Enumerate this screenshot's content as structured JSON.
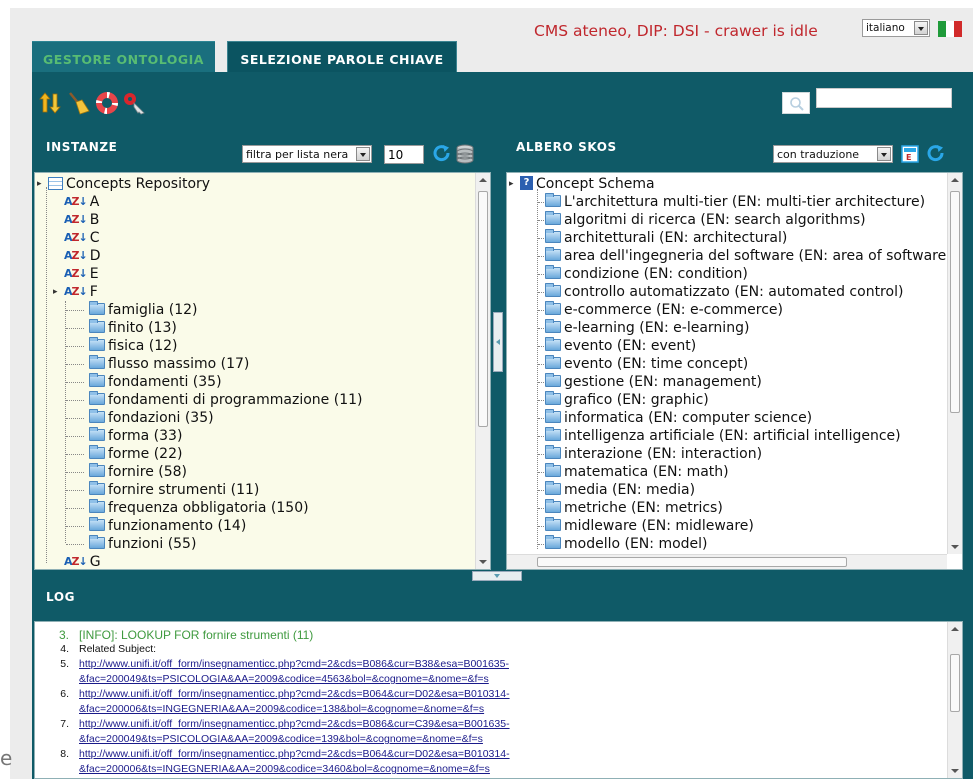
{
  "header": {
    "status": "CMS ateneo, DIP: DSI - crawer is idle",
    "language": "italiano",
    "flag_colors": [
      "#1f9b3a",
      "#ffffff",
      "#d12a2a"
    ]
  },
  "tabs": [
    {
      "label": "GESTORE ONTOLOGIA",
      "active": false
    },
    {
      "label": "SELEZIONE PAROLE CHIAVE",
      "active": true
    }
  ],
  "toolbar": {
    "icons": [
      "sort-arrows-icon",
      "broom-icon",
      "lifebuoy-icon",
      "key-icon"
    ],
    "search_placeholder": ""
  },
  "instanze": {
    "title": "INSTANZE",
    "filter": "filtra per lista nera",
    "limit": "10",
    "root": "Concepts Repository",
    "letters": [
      "A",
      "B",
      "C",
      "D",
      "E",
      "F",
      "G"
    ],
    "f_children": [
      "famiglia (12)",
      "finito (13)",
      "fisica (12)",
      "flusso massimo (17)",
      "fondamenti (35)",
      "fondamenti di programmazione (11)",
      "fondazioni (35)",
      "forma (33)",
      "forme (22)",
      "fornire (58)",
      "fornire strumenti (11)",
      "frequenza obbligatoria (150)",
      "funzionamento (14)",
      "funzioni (55)"
    ]
  },
  "albero": {
    "title": "ALBERO SKOS",
    "mode": "con traduzione",
    "root": "Concept Schema",
    "items": [
      "L'architettura multi-tier (EN: multi-tier architecture)",
      "algoritmi di ricerca (EN: search algorithms)",
      "architetturali (EN: architectural)",
      "area dell'ingegneria del software (EN: area of software engineering)",
      "condizione (EN: condition)",
      "controllo automatizzato (EN: automated control)",
      "e-commerce (EN: e-commerce)",
      "e-learning (EN: e-learning)",
      "evento (EN: event)",
      "evento (EN: time concept)",
      "gestione (EN: management)",
      "grafico (EN: graphic)",
      "informatica (EN: computer science)",
      "intelligenza artificiale (EN: artificial intelligence)",
      "interazione (EN: interaction)",
      "matematica (EN: math)",
      "media (EN: media)",
      "metriche (EN: metrics)",
      "midleware (EN: midleware)",
      "modello (EN: model)"
    ]
  },
  "log": {
    "title": "LOG",
    "lines": [
      {
        "n": "3.",
        "text": "[INFO]: LOOKUP FOR fornire strumenti (11)",
        "kind": "info"
      },
      {
        "n": "4.",
        "text": "Related Subject:",
        "kind": "plain"
      },
      {
        "n": "5.",
        "text": "http://www.unifi.it/off_form/insegnamenticc.php?cmd=2&cds=B086&cur=B38&esa=B001635-",
        "kind": "link"
      },
      {
        "n": "",
        "text": "&fac=200049&ts=PSICOLOGIA&AA=2009&codice=4563&bol=&cognome=&nome=&f=s",
        "kind": "link"
      },
      {
        "n": "6.",
        "text": "http://www.unifi.it/off_form/insegnamenticc.php?cmd=2&cds=B064&cur=D02&esa=B010314-",
        "kind": "link"
      },
      {
        "n": "",
        "text": "&fac=200006&ts=INGEGNERIA&AA=2009&codice=138&bol=&cognome=&nome=&f=s",
        "kind": "link"
      },
      {
        "n": "7.",
        "text": "http://www.unifi.it/off_form/insegnamenticc.php?cmd=2&cds=B086&cur=C39&esa=B001635-",
        "kind": "link"
      },
      {
        "n": "",
        "text": "&fac=200049&ts=PSICOLOGIA&AA=2009&codice=139&bol=&cognome=&nome=&f=s",
        "kind": "link"
      },
      {
        "n": "8.",
        "text": "http://www.unifi.it/off_form/insegnamenticc.php?cmd=2&cds=B064&cur=D02&esa=B010314-",
        "kind": "link"
      },
      {
        "n": "",
        "text": "&fac=200006&ts=INGEGNERIA&AA=2009&codice=3460&bol=&cognome=&nome=&f=s",
        "kind": "link"
      }
    ]
  },
  "stray_char": "e",
  "colors": {
    "teal_dark": "#0f5a67",
    "tab_text_green": "#58bc73",
    "status_red": "#c0272d",
    "log_info_green": "#3f9a3f"
  }
}
